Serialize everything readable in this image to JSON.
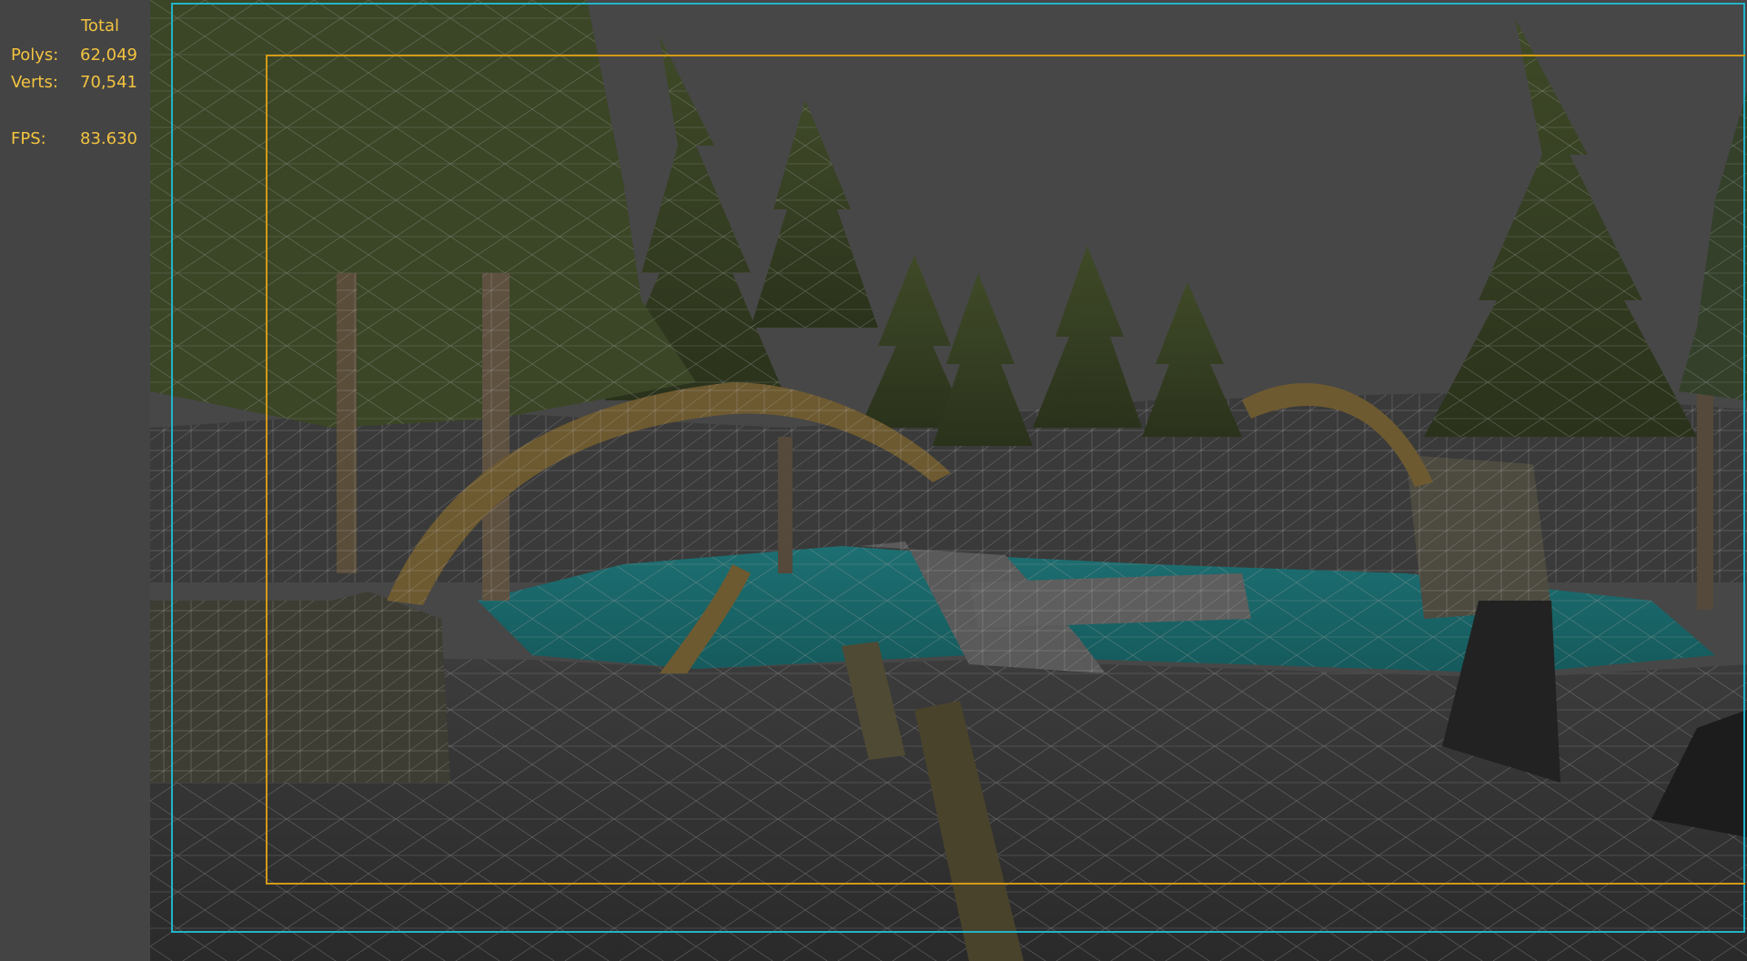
{
  "stats": {
    "header": "Total",
    "polys": {
      "label": "Polys:",
      "value": "62,049"
    },
    "verts": {
      "label": "Verts:",
      "value": "70,541"
    },
    "fps": {
      "label": "FPS:",
      "value": "83.630"
    }
  },
  "colors": {
    "stats_text": "#f3c340",
    "safe_frame_outer": "#22b4c8",
    "safe_frame_inner": "#d49a16",
    "background": "#454545",
    "water": "#1f6e70"
  }
}
